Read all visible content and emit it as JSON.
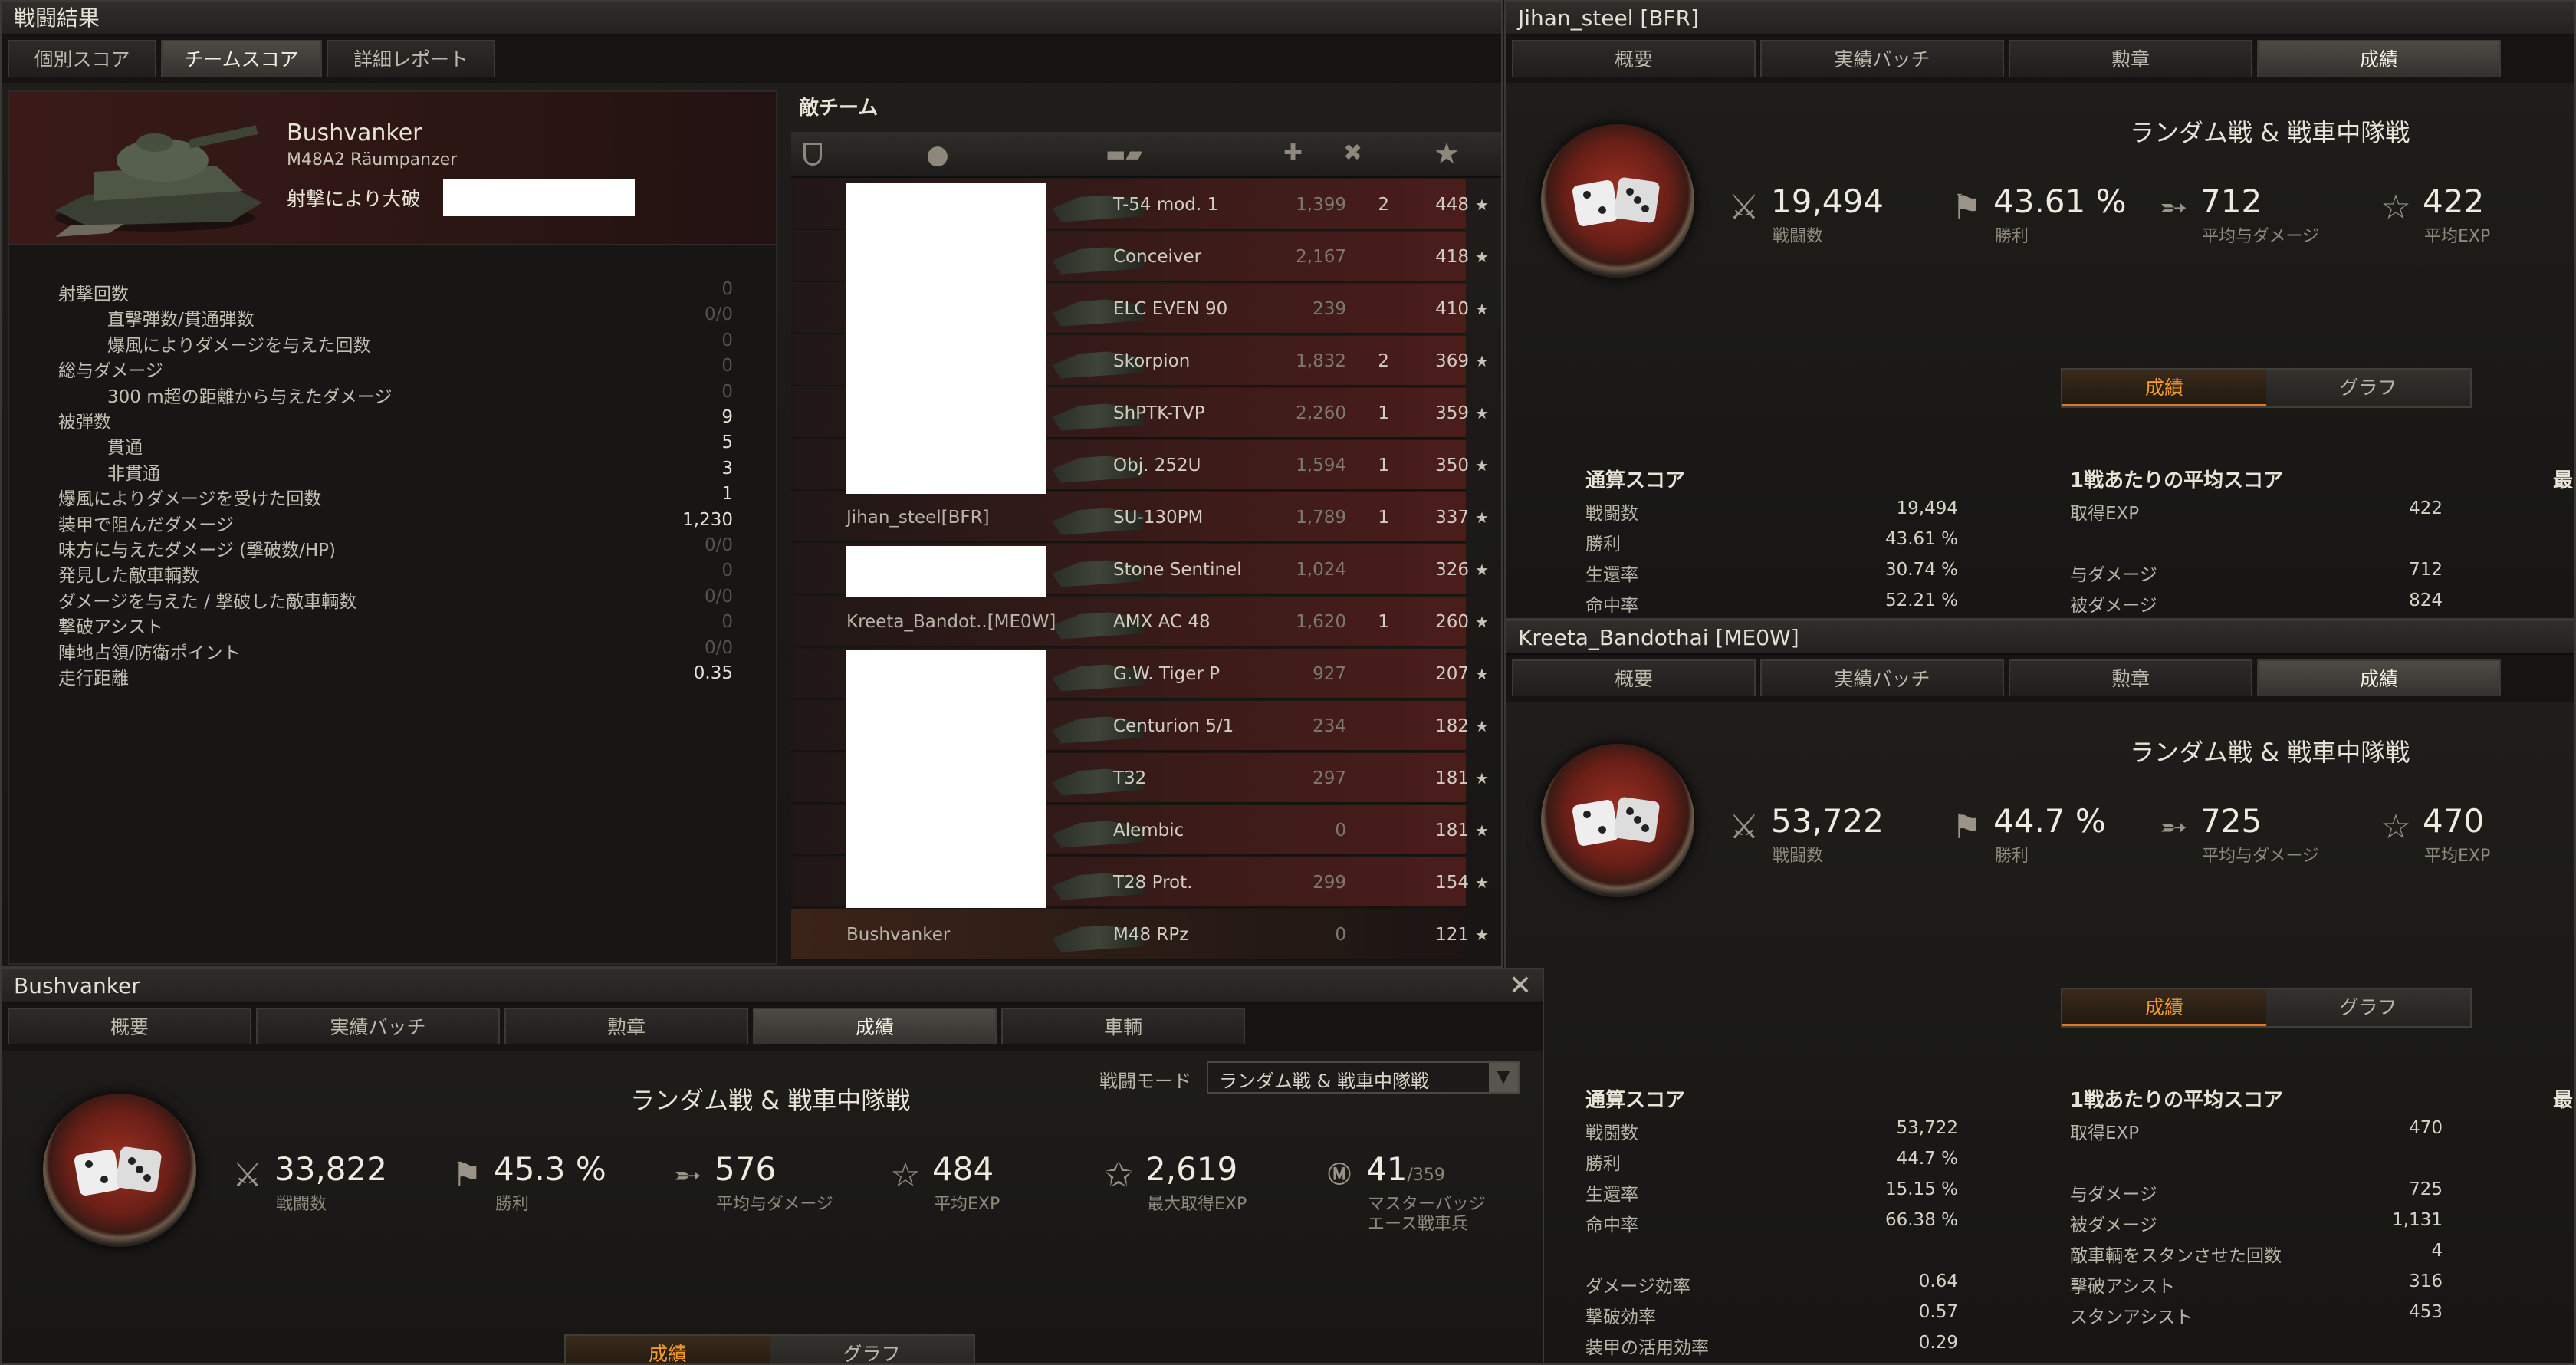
{
  "battle_window": {
    "title": "戦闘結果",
    "tabs": [
      "個別スコア",
      "チームスコア",
      "詳細レポート"
    ],
    "active_tab": 1,
    "player_name": "Bushvanker",
    "tank_name": "M48A2 Räumpanzer",
    "destroyed_label": "射撃により大破",
    "details": [
      {
        "label": "射撃回数",
        "value": "0",
        "indent": 0
      },
      {
        "label": "直撃弾数/貫通弾数",
        "value": "0/0",
        "indent": 1
      },
      {
        "label": "爆風によりダメージを与えた回数",
        "value": "0",
        "indent": 1
      },
      {
        "label": "総与ダメージ",
        "value": "0",
        "indent": 0
      },
      {
        "label": "300 m超の距離から与えたダメージ",
        "value": "0",
        "indent": 1
      },
      {
        "label": "被弾数",
        "value": "9",
        "indent": 0,
        "bright": true
      },
      {
        "label": "貫通",
        "value": "5",
        "indent": 1,
        "bright": true
      },
      {
        "label": "非貫通",
        "value": "3",
        "indent": 1,
        "bright": true
      },
      {
        "label": "爆風によりダメージを受けた回数",
        "value": "1",
        "indent": 0,
        "bright": true
      },
      {
        "label": "装甲で阻んだダメージ",
        "value": "1,230",
        "indent": 0,
        "bright": true
      },
      {
        "label": "味方に与えたダメージ (撃破数/HP)",
        "value": "0/0",
        "indent": 0
      },
      {
        "label": "発見した敵車輌数",
        "value": "0",
        "indent": 0
      },
      {
        "label": "ダメージを与えた / 撃破した敵車輌数",
        "value": "0/0",
        "indent": 0
      },
      {
        "label": "撃破アシスト",
        "value": "0",
        "indent": 0
      },
      {
        "label": "陣地占領/防衛ポイント",
        "value": "0/0",
        "indent": 0
      },
      {
        "label": "走行距離",
        "value": "0.35",
        "indent": 0,
        "bright": true
      }
    ],
    "enemy_team": {
      "title": "敵チーム",
      "rows": [
        {
          "player": "",
          "tank": "T-54 mod. 1",
          "damage": "1,399",
          "kills": "2",
          "exp": "448"
        },
        {
          "player": "",
          "tank": "Conceiver",
          "damage": "2,167",
          "kills": "",
          "exp": "418"
        },
        {
          "player": "",
          "tank": "ELC EVEN 90",
          "damage": "239",
          "kills": "",
          "exp": "410"
        },
        {
          "player": "",
          "tank": "Skorpion",
          "damage": "1,832",
          "kills": "2",
          "exp": "369"
        },
        {
          "player": "",
          "tank": "ShPTK-TVP",
          "damage": "2,260",
          "kills": "1",
          "exp": "359"
        },
        {
          "player": "",
          "tank": "Obj. 252U",
          "damage": "1,594",
          "kills": "1",
          "exp": "350"
        },
        {
          "player": "Jihan_steel[BFR]",
          "tank": "SU-130PM",
          "damage": "1,789",
          "kills": "1",
          "exp": "337"
        },
        {
          "player": "",
          "tank": "Stone Sentinel",
          "damage": "1,024",
          "kills": "",
          "exp": "326"
        },
        {
          "player": "Kreeta_Bandot..[ME0W]",
          "tank": "AMX AC 48",
          "damage": "1,620",
          "kills": "1",
          "exp": "260"
        },
        {
          "player": "",
          "tank": "G.W. Tiger P",
          "damage": "927",
          "kills": "",
          "exp": "207"
        },
        {
          "player": "",
          "tank": "Centurion 5/1",
          "damage": "234",
          "kills": "",
          "exp": "182"
        },
        {
          "player": "",
          "tank": "T32",
          "damage": "297",
          "kills": "",
          "exp": "181"
        },
        {
          "player": "",
          "tank": "Alembic",
          "damage": "0",
          "kills": "",
          "exp": "181"
        },
        {
          "player": "",
          "tank": "T28 Prot.",
          "damage": "299",
          "kills": "",
          "exp": "154"
        },
        {
          "player": "Bushvanker",
          "tank": "M48 RPz",
          "damage": "0",
          "kills": "",
          "exp": "121"
        }
      ]
    }
  },
  "profile_tabs": [
    "概要",
    "実績バッチ",
    "勲章",
    "成績"
  ],
  "profile_tabs_bushvanker": [
    "概要",
    "実績バッチ",
    "勲章",
    "成績",
    "車輌"
  ],
  "mode_title": "ランダム戦 & 戦車中隊戦",
  "toggle": [
    "成績",
    "グラフ"
  ],
  "common_labels": {
    "battles": "戦闘数",
    "winrate": "勝利",
    "avg_damage": "平均与ダメージ",
    "avg_exp": "平均EXP",
    "max_exp": "最大取得EXP",
    "mastery": "マスターバッジ",
    "mastery2": "エース戦車兵",
    "battle_mode": "戦闘モード"
  },
  "jihan": {
    "title": "Jihan_steel [BFR]",
    "battles": "19,494",
    "winrate": "43.61 %",
    "avg_damage": "712",
    "avg_exp": "422",
    "total_head": "通算スコア",
    "avg_head": "1戦あたりの平均スコア",
    "right_head": "最",
    "total": [
      [
        "戦闘数",
        "19,494"
      ],
      [
        "勝利",
        "43.61 %"
      ],
      [
        "生還率",
        "30.74 %"
      ],
      [
        "命中率",
        "52.21 %"
      ]
    ],
    "avg": [
      [
        "取得EXP",
        "422"
      ],
      [
        "",
        ""
      ],
      [
        "与ダメージ",
        "712"
      ],
      [
        "被ダメージ",
        "824"
      ]
    ]
  },
  "kreeta": {
    "title": "Kreeta_Bandothai [ME0W]",
    "battles": "53,722",
    "winrate": "44.7 %",
    "avg_damage": "725",
    "avg_exp": "470",
    "total_head": "通算スコア",
    "avg_head": "1戦あたりの平均スコア",
    "right_head": "最",
    "total": [
      [
        "戦闘数",
        "53,722"
      ],
      [
        "勝利",
        "44.7 %"
      ],
      [
        "生還率",
        "15.15 %"
      ],
      [
        "命中率",
        "66.38 %"
      ],
      [
        "",
        ""
      ],
      [
        "ダメージ効率",
        "0.64"
      ],
      [
        "撃破効率",
        "0.57"
      ],
      [
        "装甲の活用効率",
        "0.29"
      ]
    ],
    "avg": [
      [
        "取得EXP",
        "470"
      ],
      [
        "",
        ""
      ],
      [
        "与ダメージ",
        "725"
      ],
      [
        "被ダメージ",
        "1,131"
      ],
      [
        "敵車輌をスタンさせた回数",
        "4"
      ],
      [
        "撃破アシスト",
        "316"
      ],
      [
        "スタンアシスト",
        "453"
      ]
    ]
  },
  "bush": {
    "title": "Bushvanker",
    "battles": "33,822",
    "winrate": "45.3 %",
    "avg_damage": "576",
    "avg_exp": "484",
    "max_exp": "2,619",
    "mastery": "41",
    "mastery_total": "/359",
    "mode_select": "ランダム戦 & 戦車中隊戦"
  }
}
